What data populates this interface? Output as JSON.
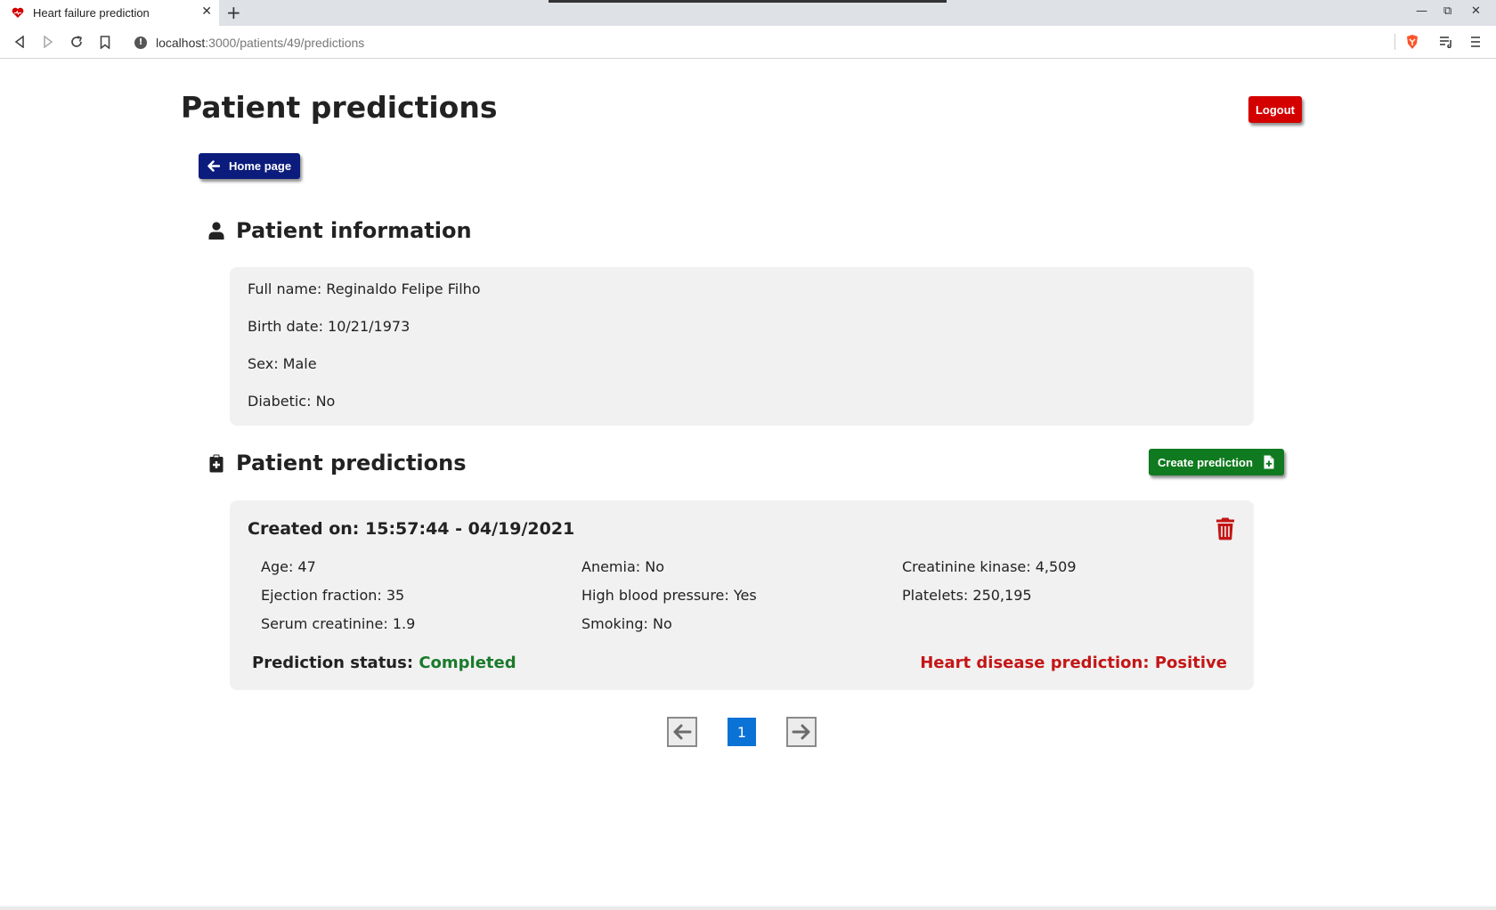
{
  "browser": {
    "tab_title": "Heart failure prediction",
    "url_host": "localhost",
    "url_rest": ":3000/patients/49/predictions"
  },
  "page": {
    "title": "Patient predictions",
    "logout_label": "Logout",
    "home_label": "Home page"
  },
  "patient_info": {
    "heading": "Patient information",
    "full_name": "Full name: Reginaldo Felipe Filho",
    "birth_date": "Birth date: 10/21/1973",
    "sex": "Sex: Male",
    "diabetic": "Diabetic: No"
  },
  "predictions": {
    "heading": "Patient predictions",
    "create_label": "Create prediction",
    "items": [
      {
        "created": "Created on: 15:57:44 - 04/19/2021",
        "age": "Age: 47",
        "anemia": "Anemia: No",
        "creatinine_kinase": "Creatinine kinase: 4,509",
        "ejection_fraction": "Ejection fraction: 35",
        "high_blood_pressure": "High blood pressure: Yes",
        "platelets": "Platelets: 250,195",
        "serum_creatinine": "Serum creatinine: 1.9",
        "smoking": "Smoking: No",
        "status_label": "Prediction status:",
        "status_value": "Completed",
        "result": "Heart disease prediction: Positive"
      }
    ]
  },
  "pagination": {
    "current_page": "1"
  },
  "colors": {
    "logout": "#d40000",
    "home": "#0b1c7d",
    "create": "#0f7a1f",
    "completed": "#1a7a2b",
    "positive": "#c41616",
    "page_active": "#0b72d6"
  }
}
